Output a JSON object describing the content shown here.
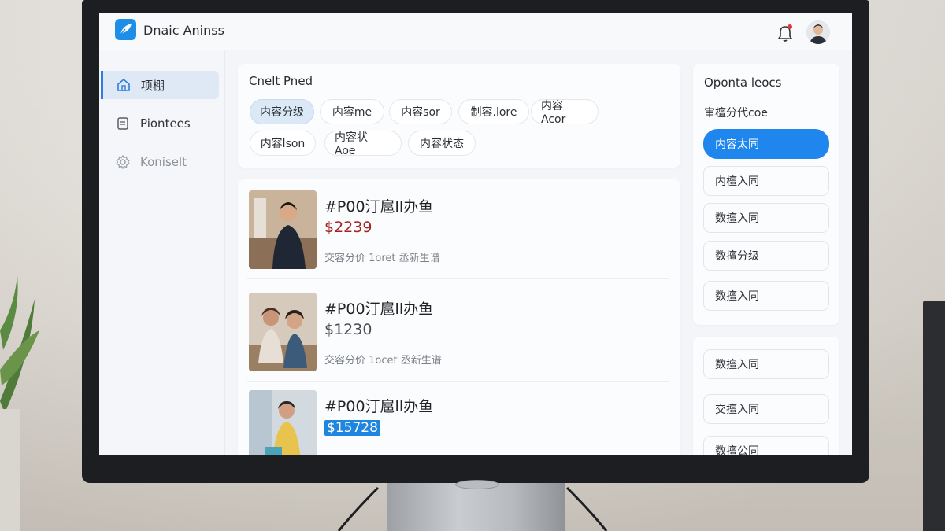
{
  "app": {
    "title": "Dnaic Aninss"
  },
  "header": {
    "has_notification": true
  },
  "sidebar": {
    "items": [
      {
        "label": "项棚",
        "icon": "home-icon",
        "active": true
      },
      {
        "label": "Piontees",
        "icon": "document-icon",
        "active": false
      },
      {
        "label": "Koniselt",
        "icon": "gear-icon",
        "active": false
      }
    ]
  },
  "filter": {
    "title": "Cnelt Pned",
    "chips": [
      {
        "label": "内容分级",
        "active": true
      },
      {
        "label": "内容me",
        "active": false
      },
      {
        "label": "内容sor",
        "active": false
      },
      {
        "label": "制容.lore",
        "active": false
      },
      {
        "label": "内容 Acor",
        "active": false
      },
      {
        "label": "内容lson",
        "active": false
      },
      {
        "label": "内容状 Aoe",
        "active": false
      },
      {
        "label": "内容状态",
        "active": false
      }
    ]
  },
  "items": [
    {
      "title": "#P00汀扈ll办鱼",
      "price": "$2239",
      "price_style": "red",
      "meta": "交容分价 1oret 丞新生谱"
    },
    {
      "title": "#P00汀扈ll办鱼",
      "price": "$1230",
      "price_style": "gray",
      "meta": "交容分价 1ocet 丞新生谱"
    },
    {
      "title": "#P00汀扈ll办鱼",
      "price": "$15728",
      "price_style": "highlight",
      "meta": ""
    }
  ],
  "options_panel": {
    "title": "Oponta leocs",
    "subtitle": "审檀分代coe",
    "options": [
      {
        "label": "内容太同",
        "selected": true
      },
      {
        "label": "内檀入同",
        "selected": false
      },
      {
        "label": "数擅入同",
        "selected": false
      },
      {
        "label": "数擅分级",
        "selected": false
      },
      {
        "label": "数擅入同",
        "selected": false
      }
    ]
  },
  "options_panel_2": {
    "options": [
      {
        "label": "数擅入同"
      },
      {
        "label": "交擅入同"
      },
      {
        "label": "数擅公同"
      }
    ]
  },
  "colors": {
    "accent": "#1e86ec",
    "price_red": "#a42222",
    "screen_bg": "#f3f5f8"
  }
}
